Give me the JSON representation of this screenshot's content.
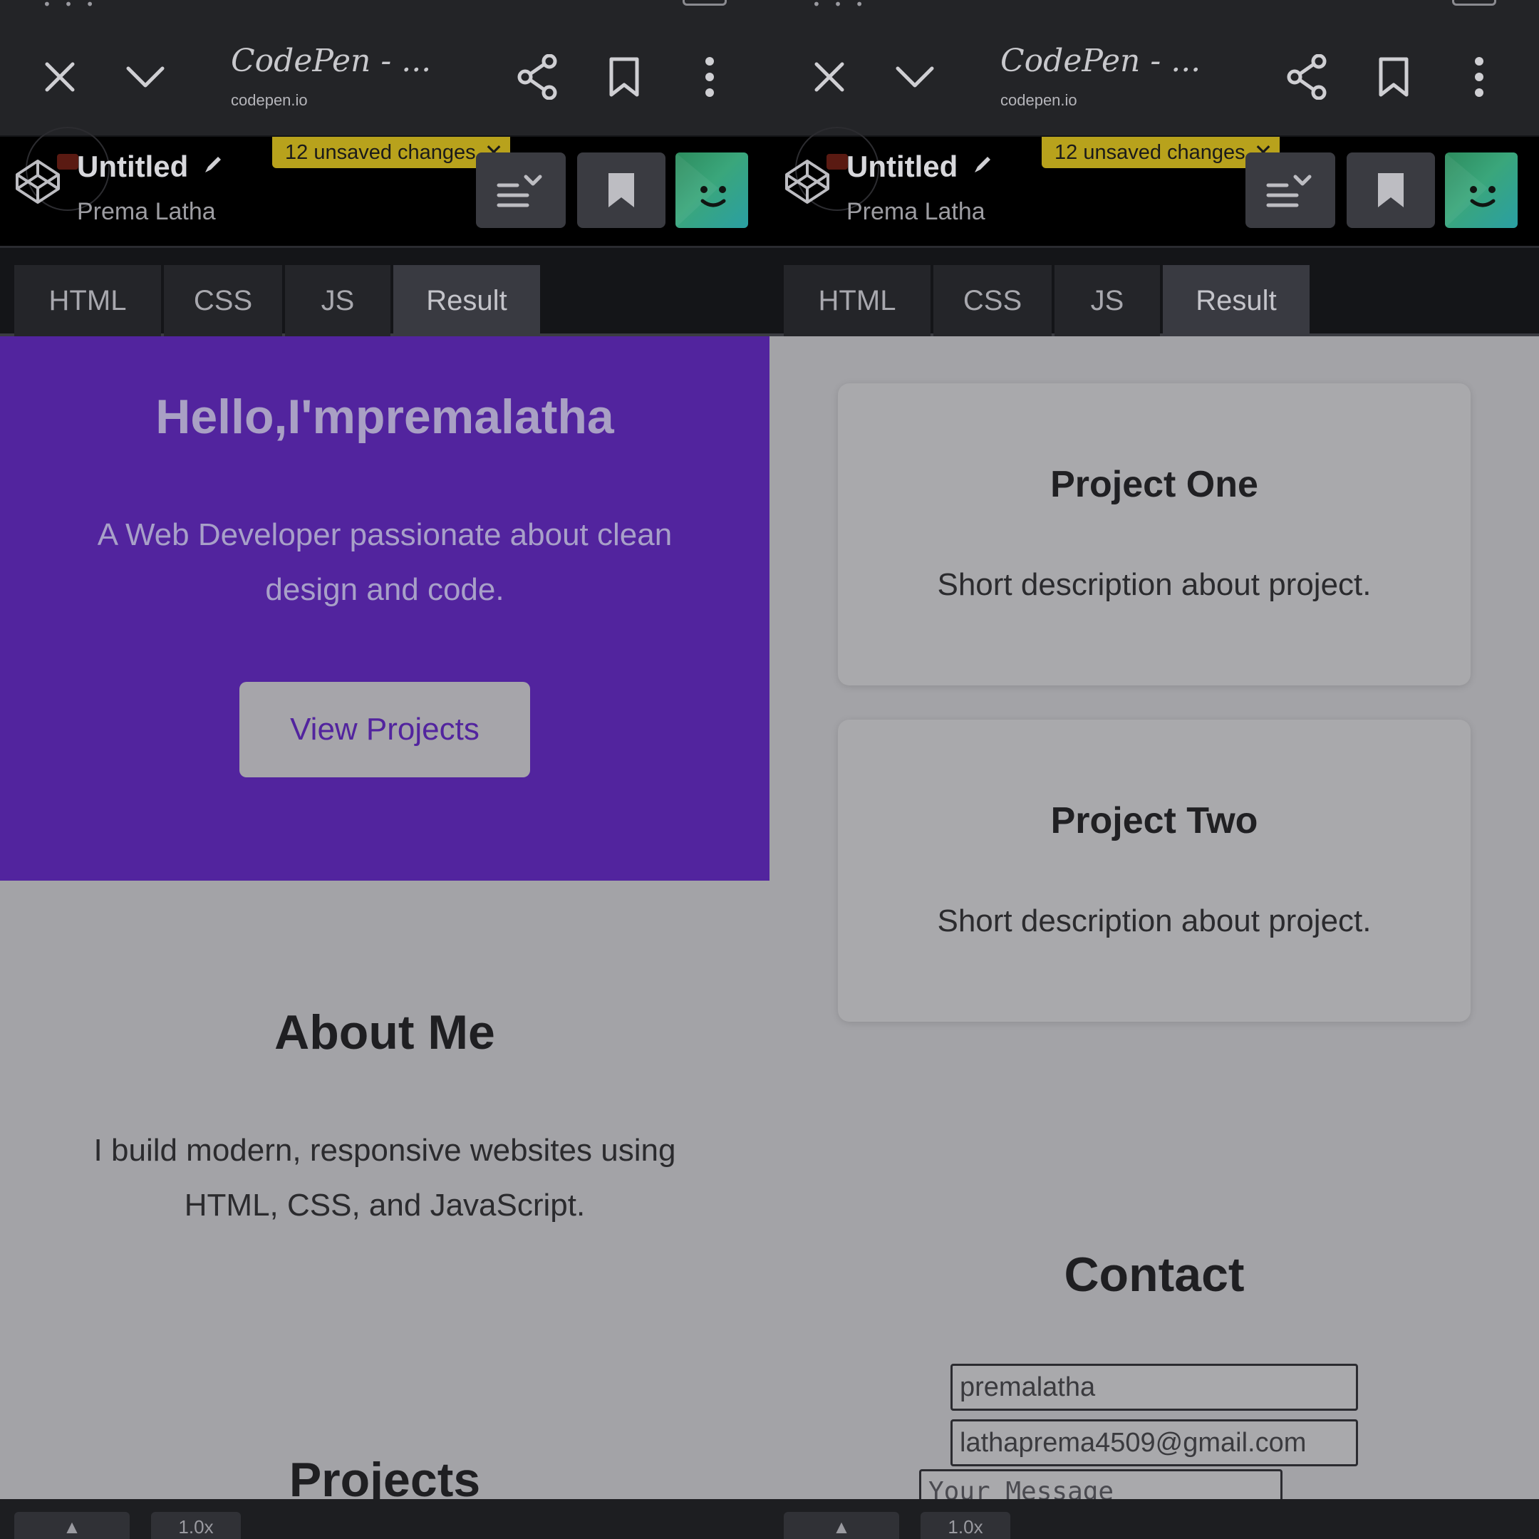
{
  "browser": {
    "tab_title": "CodePen - ...",
    "url": "codepen.io"
  },
  "codepen": {
    "pen_title": "Untitled",
    "author": "Prema Latha",
    "unsaved_badge": "12 unsaved changes",
    "tabs": [
      "HTML",
      "CSS",
      "JS",
      "Result"
    ],
    "active_tab": "Result"
  },
  "site": {
    "hero_title": "Hello,I'mpremalatha",
    "hero_subtitle": "A Web Developer passionate about clean design and code.",
    "hero_button": "View Projects",
    "about_title": "About Me",
    "about_text": "I build modern, responsive websites using HTML, CSS, and JavaScript.",
    "projects_title": "Projects",
    "projects": [
      {
        "title": "Project One",
        "description": "Short description about project."
      },
      {
        "title": "Project Two",
        "description": "Short description about project."
      }
    ],
    "contact_title": "Contact",
    "contact_name_value": "premalatha",
    "contact_email_value": "lathaprema4509@gmail.com",
    "contact_message_placeholder": "Your Message"
  },
  "bottom": {
    "zoom": "1.0x"
  },
  "colors": {
    "hero_bg": "#52249e",
    "badge_bg": "#b8a21c",
    "page_bg": "#a3a3a7",
    "header_bg": "#000000"
  },
  "icons": [
    "close-icon",
    "chevron-down-icon",
    "share-icon",
    "bookmark-icon",
    "more-vert-icon",
    "codepen-logo-icon",
    "pencil-icon",
    "layout-icon",
    "avatar-icon",
    "arrow-up-icon"
  ]
}
